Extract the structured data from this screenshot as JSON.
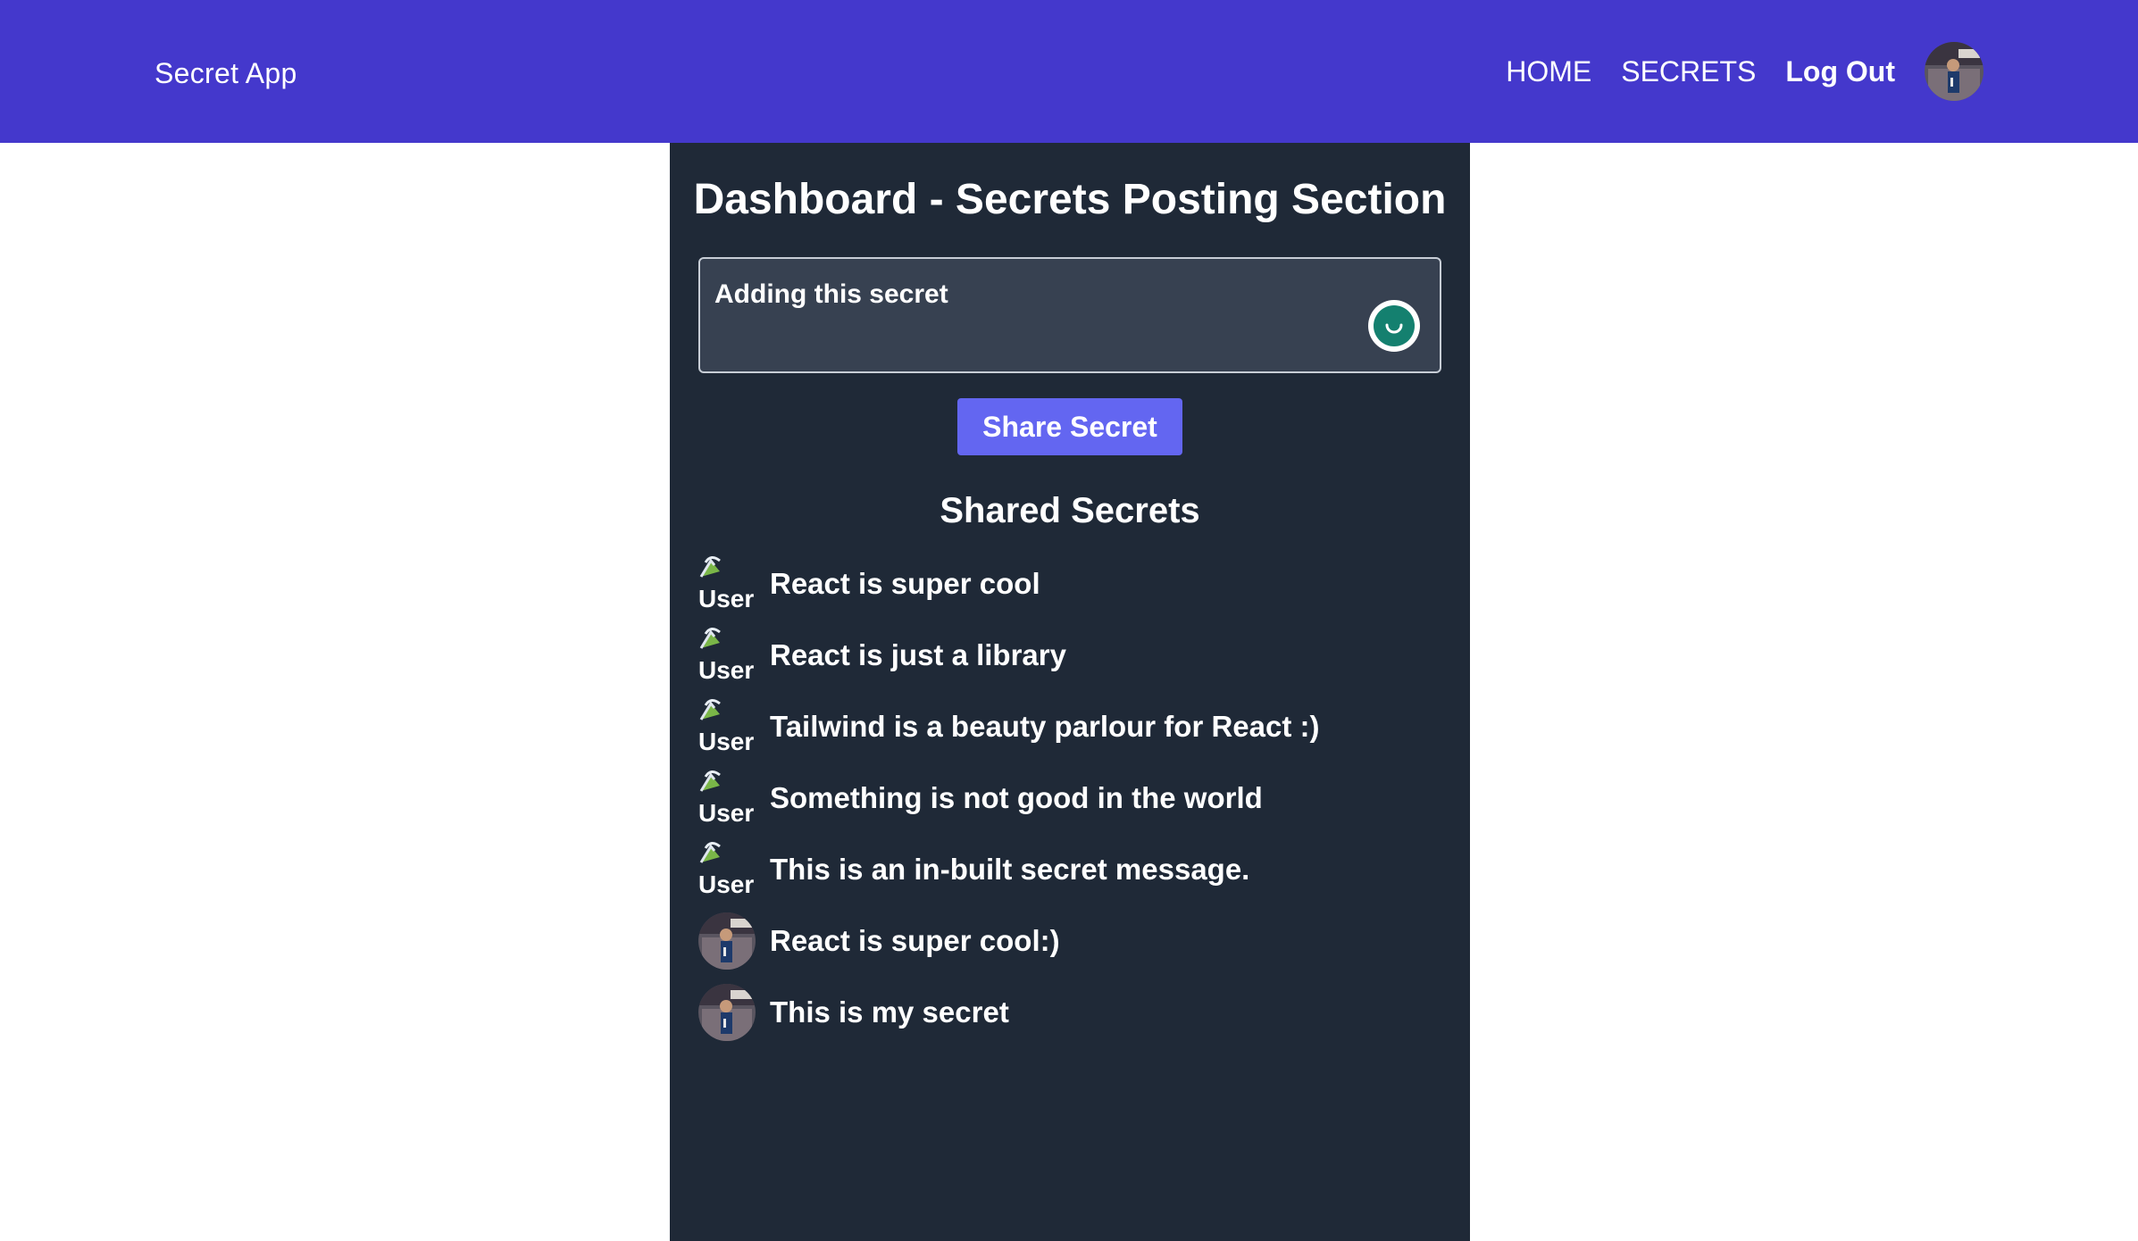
{
  "nav": {
    "brand": "Secret App",
    "links": [
      "HOME",
      "SECRETS",
      "Log Out"
    ]
  },
  "dashboard": {
    "title": "Dashboard - Secrets Posting Section",
    "secret_input_value": "Adding this secret",
    "share_button_label": "Share Secret",
    "shared_secrets_heading": "Shared Secrets"
  },
  "secrets": [
    {
      "text": "React is super cool",
      "avatar": "broken-image",
      "alt": "User"
    },
    {
      "text": "React is just a library",
      "avatar": "broken-image",
      "alt": "User"
    },
    {
      "text": "Tailwind is a beauty parlour for React :)",
      "avatar": "broken-image",
      "alt": "User"
    },
    {
      "text": "Something is not good in the world",
      "avatar": "broken-image",
      "alt": "User"
    },
    {
      "text": "This is an in-built secret message.",
      "avatar": "broken-image",
      "alt": "User"
    },
    {
      "text": "React is super cool:)",
      "avatar": "user-photo"
    },
    {
      "text": "This is my secret",
      "avatar": "user-photo"
    }
  ],
  "colors": {
    "navbar": "#4438cc",
    "panel": "#1f2937",
    "input_bg": "#374151",
    "button": "#6366f1",
    "grammar_widget": "#14806f"
  }
}
